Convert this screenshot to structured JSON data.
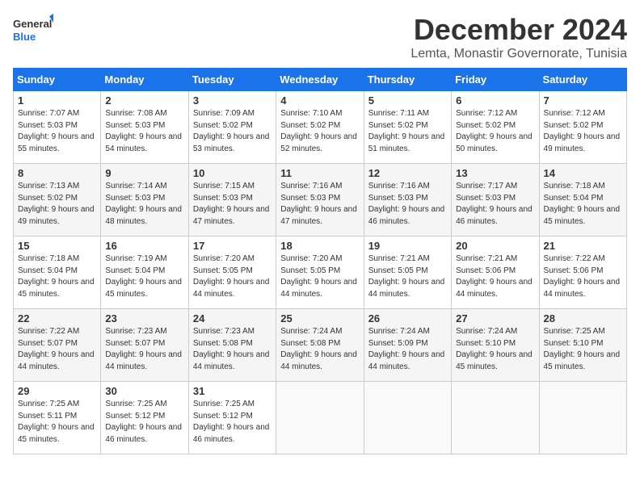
{
  "logo": {
    "line1": "General",
    "line2": "Blue"
  },
  "title": "December 2024",
  "subtitle": "Lemta, Monastir Governorate, Tunisia",
  "weekdays": [
    "Sunday",
    "Monday",
    "Tuesday",
    "Wednesday",
    "Thursday",
    "Friday",
    "Saturday"
  ],
  "weeks": [
    [
      {
        "day": 1,
        "sunrise": "7:07 AM",
        "sunset": "5:03 PM",
        "daylight": "9 hours and 55 minutes."
      },
      {
        "day": 2,
        "sunrise": "7:08 AM",
        "sunset": "5:03 PM",
        "daylight": "9 hours and 54 minutes."
      },
      {
        "day": 3,
        "sunrise": "7:09 AM",
        "sunset": "5:02 PM",
        "daylight": "9 hours and 53 minutes."
      },
      {
        "day": 4,
        "sunrise": "7:10 AM",
        "sunset": "5:02 PM",
        "daylight": "9 hours and 52 minutes."
      },
      {
        "day": 5,
        "sunrise": "7:11 AM",
        "sunset": "5:02 PM",
        "daylight": "9 hours and 51 minutes."
      },
      {
        "day": 6,
        "sunrise": "7:12 AM",
        "sunset": "5:02 PM",
        "daylight": "9 hours and 50 minutes."
      },
      {
        "day": 7,
        "sunrise": "7:12 AM",
        "sunset": "5:02 PM",
        "daylight": "9 hours and 49 minutes."
      }
    ],
    [
      {
        "day": 8,
        "sunrise": "7:13 AM",
        "sunset": "5:02 PM",
        "daylight": "9 hours and 49 minutes."
      },
      {
        "day": 9,
        "sunrise": "7:14 AM",
        "sunset": "5:03 PM",
        "daylight": "9 hours and 48 minutes."
      },
      {
        "day": 10,
        "sunrise": "7:15 AM",
        "sunset": "5:03 PM",
        "daylight": "9 hours and 47 minutes."
      },
      {
        "day": 11,
        "sunrise": "7:16 AM",
        "sunset": "5:03 PM",
        "daylight": "9 hours and 47 minutes."
      },
      {
        "day": 12,
        "sunrise": "7:16 AM",
        "sunset": "5:03 PM",
        "daylight": "9 hours and 46 minutes."
      },
      {
        "day": 13,
        "sunrise": "7:17 AM",
        "sunset": "5:03 PM",
        "daylight": "9 hours and 46 minutes."
      },
      {
        "day": 14,
        "sunrise": "7:18 AM",
        "sunset": "5:04 PM",
        "daylight": "9 hours and 45 minutes."
      }
    ],
    [
      {
        "day": 15,
        "sunrise": "7:18 AM",
        "sunset": "5:04 PM",
        "daylight": "9 hours and 45 minutes."
      },
      {
        "day": 16,
        "sunrise": "7:19 AM",
        "sunset": "5:04 PM",
        "daylight": "9 hours and 45 minutes."
      },
      {
        "day": 17,
        "sunrise": "7:20 AM",
        "sunset": "5:05 PM",
        "daylight": "9 hours and 44 minutes."
      },
      {
        "day": 18,
        "sunrise": "7:20 AM",
        "sunset": "5:05 PM",
        "daylight": "9 hours and 44 minutes."
      },
      {
        "day": 19,
        "sunrise": "7:21 AM",
        "sunset": "5:05 PM",
        "daylight": "9 hours and 44 minutes."
      },
      {
        "day": 20,
        "sunrise": "7:21 AM",
        "sunset": "5:06 PM",
        "daylight": "9 hours and 44 minutes."
      },
      {
        "day": 21,
        "sunrise": "7:22 AM",
        "sunset": "5:06 PM",
        "daylight": "9 hours and 44 minutes."
      }
    ],
    [
      {
        "day": 22,
        "sunrise": "7:22 AM",
        "sunset": "5:07 PM",
        "daylight": "9 hours and 44 minutes."
      },
      {
        "day": 23,
        "sunrise": "7:23 AM",
        "sunset": "5:07 PM",
        "daylight": "9 hours and 44 minutes."
      },
      {
        "day": 24,
        "sunrise": "7:23 AM",
        "sunset": "5:08 PM",
        "daylight": "9 hours and 44 minutes."
      },
      {
        "day": 25,
        "sunrise": "7:24 AM",
        "sunset": "5:08 PM",
        "daylight": "9 hours and 44 minutes."
      },
      {
        "day": 26,
        "sunrise": "7:24 AM",
        "sunset": "5:09 PM",
        "daylight": "9 hours and 44 minutes."
      },
      {
        "day": 27,
        "sunrise": "7:24 AM",
        "sunset": "5:10 PM",
        "daylight": "9 hours and 45 minutes."
      },
      {
        "day": 28,
        "sunrise": "7:25 AM",
        "sunset": "5:10 PM",
        "daylight": "9 hours and 45 minutes."
      }
    ],
    [
      {
        "day": 29,
        "sunrise": "7:25 AM",
        "sunset": "5:11 PM",
        "daylight": "9 hours and 45 minutes."
      },
      {
        "day": 30,
        "sunrise": "7:25 AM",
        "sunset": "5:12 PM",
        "daylight": "9 hours and 46 minutes."
      },
      {
        "day": 31,
        "sunrise": "7:25 AM",
        "sunset": "5:12 PM",
        "daylight": "9 hours and 46 minutes."
      },
      null,
      null,
      null,
      null
    ]
  ]
}
